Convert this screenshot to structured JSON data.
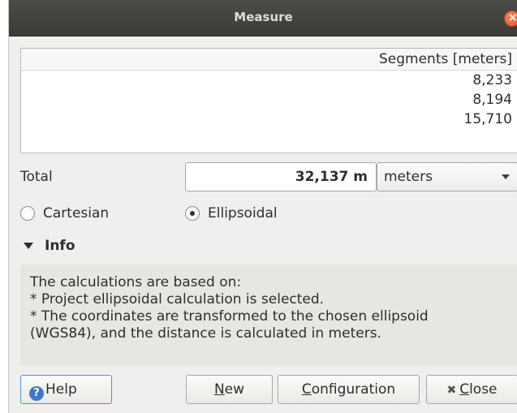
{
  "window": {
    "title": "Measure"
  },
  "segments": {
    "header": "Segments [meters]",
    "rows": [
      "8,233",
      "8,194",
      "15,710"
    ]
  },
  "total": {
    "label": "Total",
    "value": "32,137 m",
    "units": "meters"
  },
  "mode": {
    "cartesian_label": "Cartesian",
    "ellipsoidal_label": "Ellipsoidal",
    "selected": "Ellipsoidal"
  },
  "info": {
    "header": "Info",
    "lines": [
      "The calculations are based on:",
      "* Project ellipsoidal calculation is selected.",
      "* The coordinates are transformed to the chosen ellipsoid",
      "(WGS84), and the distance is calculated in meters."
    ]
  },
  "buttons": {
    "help_label": "Help",
    "new_first": "N",
    "new_rest": "ew",
    "configuration_first": "C",
    "configuration_rest": "onfiguration",
    "close_first": "C",
    "close_rest": "lose"
  },
  "icons": {
    "close": "close-icon",
    "help": "help-icon",
    "dropdown": "chevron-down-icon",
    "collapse": "triangle-down-icon"
  },
  "colors": {
    "titlebar": "#3f3f3b",
    "close_button": "#e8693a",
    "help_accent": "#3f78c8"
  }
}
